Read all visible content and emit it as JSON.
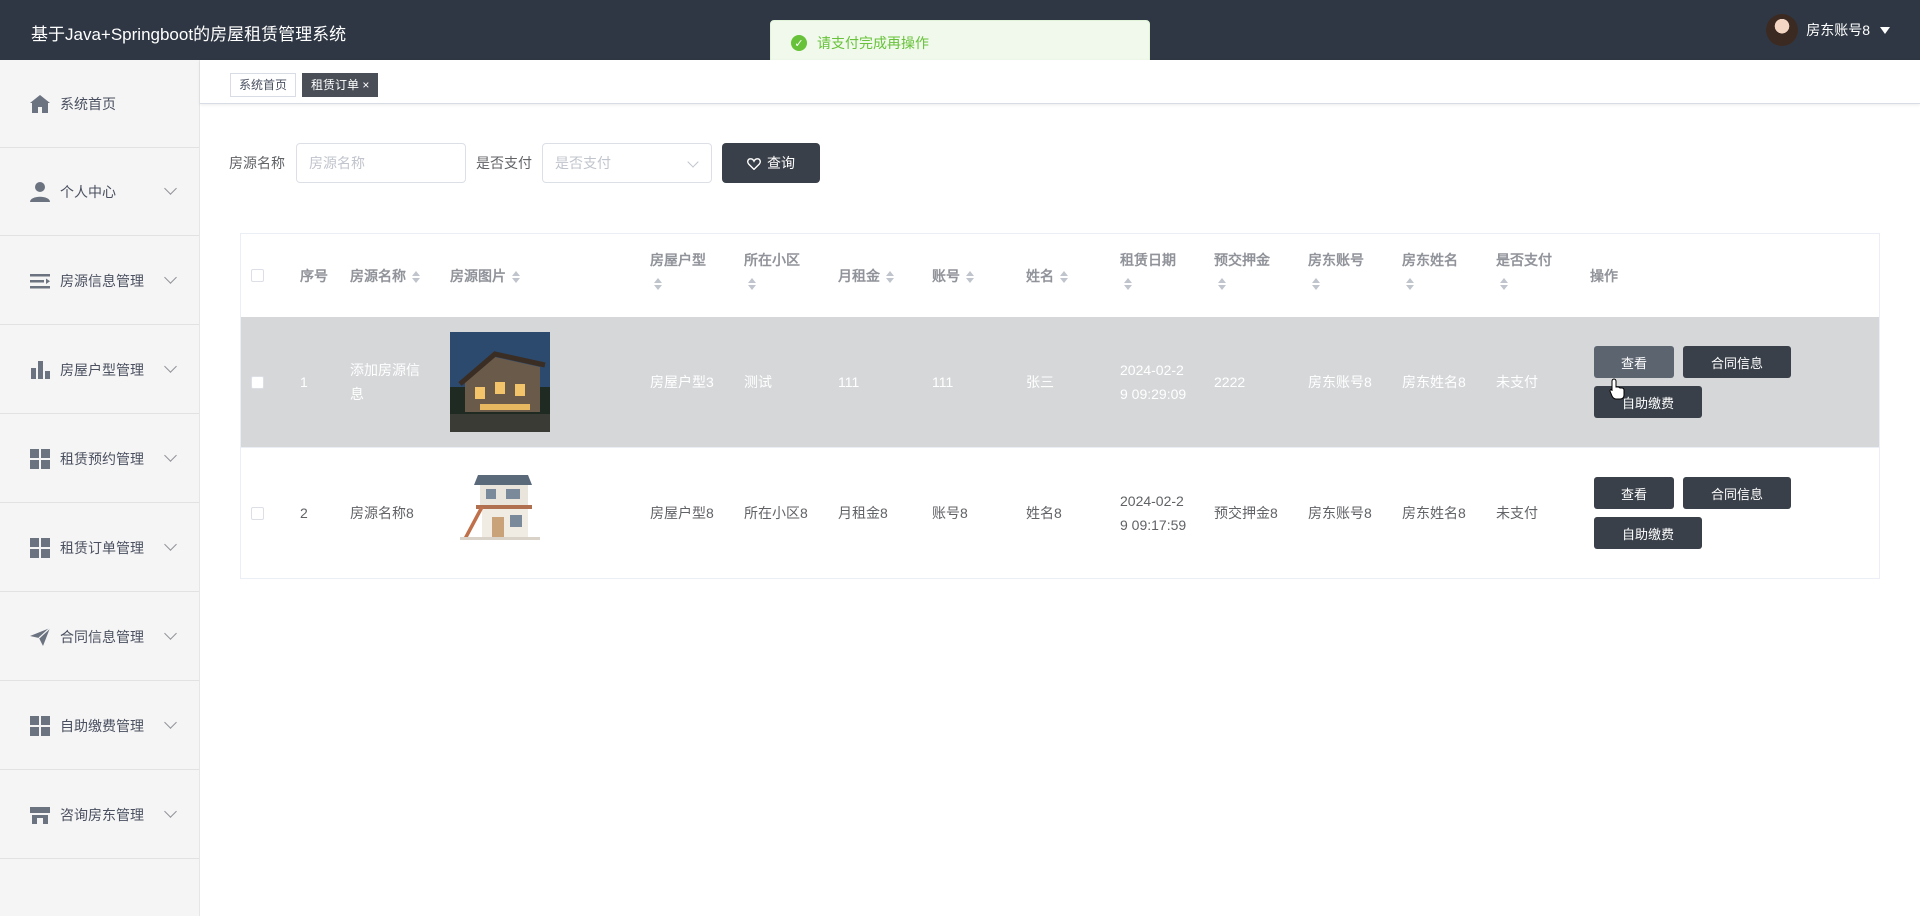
{
  "header": {
    "title": "基于Java+Springboot的房屋租赁管理系统",
    "user_name": "房东账号8"
  },
  "toast": {
    "message": "请支付完成再操作"
  },
  "sidebar": {
    "items": [
      {
        "label": "系统首页",
        "icon": "home-icon"
      },
      {
        "label": "个人中心",
        "icon": "user-icon"
      },
      {
        "label": "房源信息管理",
        "icon": "list-icon"
      },
      {
        "label": "房屋户型管理",
        "icon": "bar-chart-icon"
      },
      {
        "label": "租赁预约管理",
        "icon": "grid-icon"
      },
      {
        "label": "租赁订单管理",
        "icon": "grid-icon"
      },
      {
        "label": "合同信息管理",
        "icon": "paper-plane-icon"
      },
      {
        "label": "自助缴费管理",
        "icon": "grid-icon"
      },
      {
        "label": "咨询房东管理",
        "icon": "store-icon"
      }
    ]
  },
  "tags": [
    {
      "label": "系统首页"
    },
    {
      "label": "租赁订单 ×"
    }
  ],
  "search": {
    "name_label": "房源名称",
    "name_placeholder": "房源名称",
    "pay_label": "是否支付",
    "pay_placeholder": "是否支付",
    "query_label": "查询"
  },
  "table": {
    "headers": {
      "index": "序号",
      "name": "房源名称",
      "image": "房源图片",
      "type": "房屋户型",
      "community": "所在小区",
      "rent": "月租金",
      "account": "账号",
      "person": "姓名",
      "date": "租赁日期",
      "deposit": "预交押金",
      "landlord_account": "房东账号",
      "landlord_name": "房东姓名",
      "paid": "是否支付",
      "actions": "操作"
    },
    "rows": [
      {
        "index": "1",
        "name_l1": "添加房源信",
        "name_l2": "息",
        "type": "房屋户型3",
        "community": "测试",
        "rent": "111",
        "account": "111",
        "person": "张三",
        "date_l1": "2024-02-2",
        "date_l2": "9 09:29:09",
        "deposit": "2222",
        "landlord_account": "房东账号8",
        "landlord_name": "房东姓名8",
        "paid": "未支付"
      },
      {
        "index": "2",
        "name_l1": "房源名称8",
        "name_l2": "",
        "type": "房屋户型8",
        "community": "所在小区8",
        "rent": "月租金8",
        "account": "账号8",
        "person": "姓名8",
        "date_l1": "2024-02-2",
        "date_l2": "9 09:17:59",
        "deposit": "预交押金8",
        "landlord_account": "房东账号8",
        "landlord_name": "房东姓名8",
        "paid": "未支付"
      }
    ],
    "actions": {
      "view": "查看",
      "contract": "合同信息",
      "pay": "自助缴费"
    }
  }
}
